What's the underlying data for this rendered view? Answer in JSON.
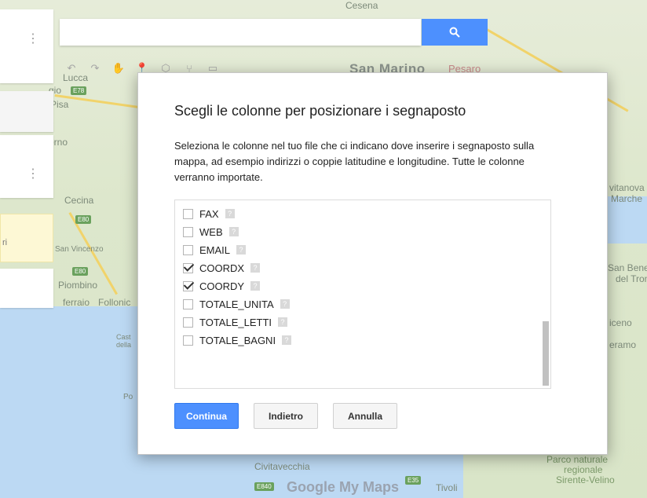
{
  "search": {
    "placeholder": "",
    "button_icon": "search-icon"
  },
  "toolbar": {
    "icons": [
      "undo-icon",
      "redo-icon",
      "hand-icon",
      "marker-icon",
      "shape-icon",
      "route-icon",
      "ruler-icon"
    ]
  },
  "left_panel": {
    "yellow_text": "ri"
  },
  "map_labels": {
    "cesena": "Cesena",
    "san_marino": "San Marino",
    "pesaro": "Pesaro",
    "lucca": "Lucca",
    "pisa": "Pisa",
    "gio": "gio",
    "orno": "orno",
    "cecina": "Cecina",
    "san_vincenzo": "San Vincenzo",
    "piombino": "Piombino",
    "ferraio": "ferraio",
    "follonica": "Follonic",
    "castiglione": "Cast",
    "della": "della",
    "po": "Po",
    "civitavecchia": "Civitavecchia",
    "vitanova": "vitanova",
    "marche": "Marche",
    "san_bened": "San Bened",
    "del_tront": "del Tront",
    "iceno": "iceno",
    "eramo": "eramo",
    "parco": "Parco naturale",
    "regionale": "regionale",
    "sirente": "Sirente-Velino",
    "tivoli": "Tivoli",
    "e78": "E78",
    "e80": "E80",
    "e80b": "E80",
    "e840": "E840",
    "e35": "E35",
    "footer": "Google My Maps"
  },
  "dialog": {
    "title": "Scegli le colonne per posizionare i segnaposto",
    "description": "Seleziona le colonne nel tuo file che ci indicano dove inserire i segnaposto sulla mappa, ad esempio indirizzi o coppie latitudine e longitudine. Tutte le colonne verranno importate.",
    "help_glyph": "?",
    "columns": [
      {
        "label": "FAX",
        "checked": false
      },
      {
        "label": "WEB",
        "checked": false
      },
      {
        "label": "EMAIL",
        "checked": false
      },
      {
        "label": "COORDX",
        "checked": true
      },
      {
        "label": "COORDY",
        "checked": true
      },
      {
        "label": "TOTALE_UNITA",
        "checked": false
      },
      {
        "label": "TOTALE_LETTI",
        "checked": false
      },
      {
        "label": "TOTALE_BAGNI",
        "checked": false
      }
    ],
    "buttons": {
      "continua": "Continua",
      "indietro": "Indietro",
      "annulla": "Annulla"
    }
  },
  "colors": {
    "accent": "#4d90fe",
    "map_land": "#dfe7d4",
    "map_water": "#bcd9f3"
  }
}
